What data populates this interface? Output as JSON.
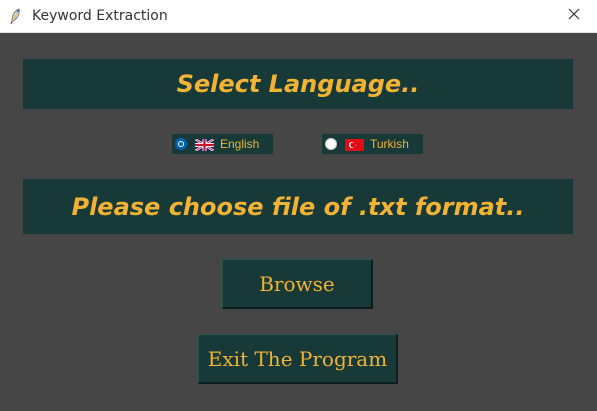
{
  "window": {
    "title": "Keyword Extraction",
    "icons": {
      "app": "feather-quill-icon",
      "close": "close-icon"
    }
  },
  "language_section": {
    "heading": "Select Language..",
    "options": [
      {
        "label": "English",
        "flag": "uk-flag-icon",
        "checked": true
      },
      {
        "label": "Turkish",
        "flag": "turkey-flag-icon",
        "checked": false
      }
    ]
  },
  "file_section": {
    "heading": "Please choose file of .txt format.."
  },
  "buttons": {
    "browse": "Browse",
    "exit": "Exit The Program"
  },
  "colors": {
    "background": "#464646",
    "panel": "#173a38",
    "accent_text": "#f2b233",
    "radio_selected": "#0063b1"
  }
}
